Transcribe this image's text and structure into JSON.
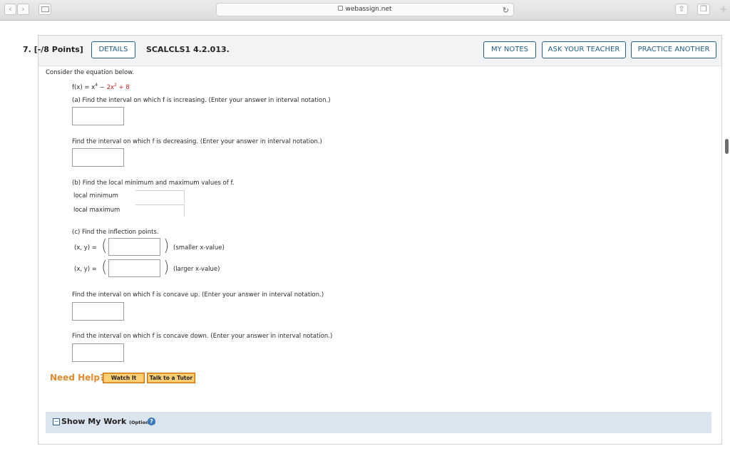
{
  "browser": {
    "url": "webassign.net",
    "back": "‹",
    "forward": "›",
    "reload": "↻",
    "share": "⇧",
    "tabs": "❐",
    "new_tab": "+"
  },
  "question": {
    "number": "7.",
    "points": "[-/8 Points]",
    "details_label": "DETAILS",
    "id": "SCALCLS1 4.2.013.",
    "my_notes": "MY NOTES",
    "ask_teacher": "ASK YOUR TEACHER",
    "practice_another": "PRACTICE ANOTHER"
  },
  "body": {
    "intro": "Consider the equation below.",
    "eq_lhs": "f(x) = x",
    "eq_exp1": "4",
    "eq_mid": " − ",
    "eq_term2": "2x",
    "eq_exp2": "2",
    "eq_term3": " + 8",
    "part_a_inc": "(a) Find the interval on which f is increasing. (Enter your answer in interval notation.)",
    "part_a_dec": "Find the interval on which f is decreasing. (Enter your answer in interval notation.)",
    "part_b": "(b) Find the local minimum and maximum values of f.",
    "local_min": "local minimum",
    "local_max": "local maximum",
    "part_c": "(c) Find the inflection points.",
    "xy_label": "(x, y) =",
    "smaller": "(smaller x-value)",
    "larger": "(larger x-value)",
    "concave_up": "Find the interval on which f is concave up. (Enter your answer in interval notation.)",
    "concave_down": "Find the interval on which f is concave down. (Enter your answer in interval notation.)"
  },
  "help": {
    "need_help": "Need Help?",
    "watch_it": "Watch It",
    "talk_tutor": "Talk to a Tutor"
  },
  "show_work": {
    "toggle": "−",
    "label": "Show My Work",
    "optional": "(Optional)",
    "help": "?"
  },
  "colors": {
    "accent": "#1f5f8b",
    "help_orange": "#f4a33c",
    "red_term": "#cc2222"
  }
}
